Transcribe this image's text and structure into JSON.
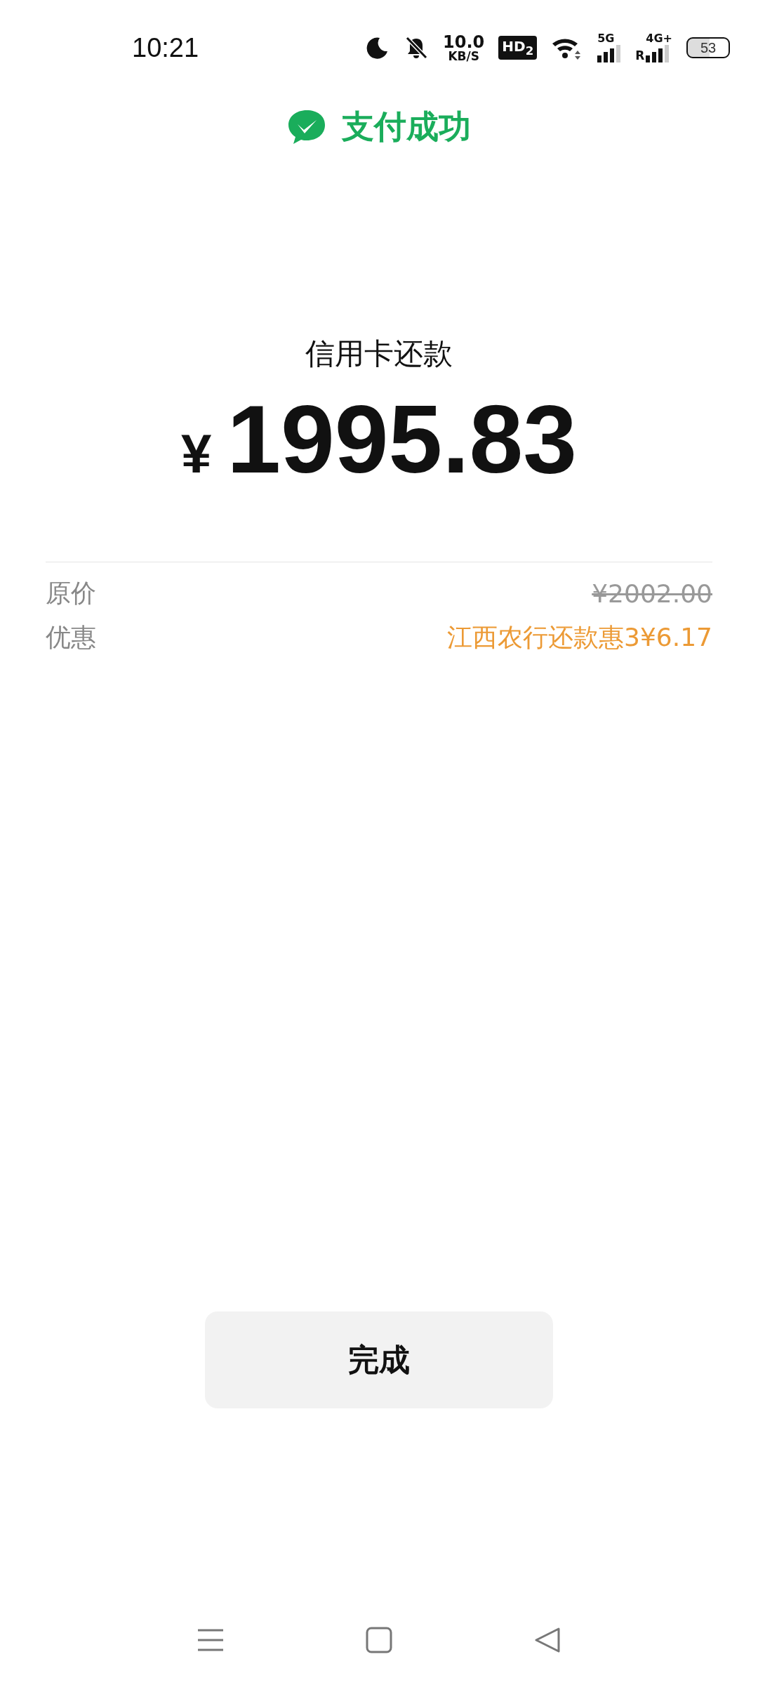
{
  "status_bar": {
    "time": "10:21",
    "speed_value": "10.0",
    "speed_unit": "KB/S",
    "hd_badge": "HD$_{2}$",
    "network_5g": "5G",
    "roaming": "R",
    "network_4g": "4G+",
    "battery": "53"
  },
  "header": {
    "title": "支付成功"
  },
  "payment": {
    "description": "信用卡还款",
    "currency": "¥",
    "amount": "1995.83"
  },
  "details": [
    {
      "kind": "original_price",
      "label": "原价",
      "value": "¥2002.00"
    },
    {
      "kind": "discount",
      "label": "优惠",
      "value": "江西农行还款惠3¥6.17"
    }
  ],
  "done_button": "完成"
}
